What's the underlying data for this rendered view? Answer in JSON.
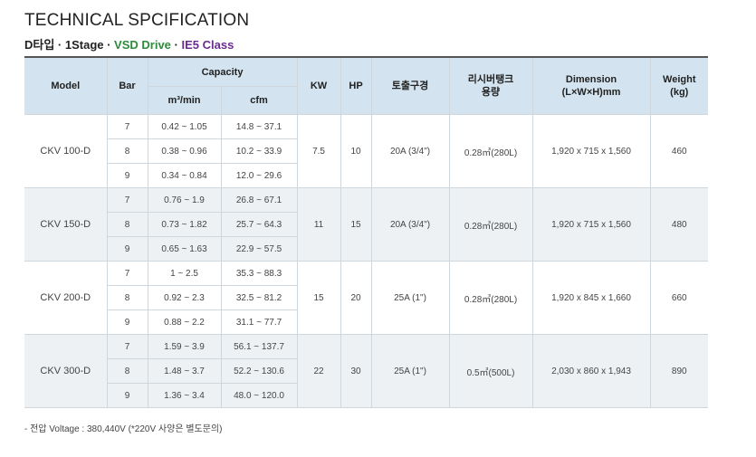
{
  "title": "TECHNICAL SPCIFICATION",
  "subtitle": {
    "part1": "D타입 · 1Stage · ",
    "part2": "VSD Drive",
    "sep": " · ",
    "part3": "IE5 Class"
  },
  "headers": {
    "model": "Model",
    "bar": "Bar",
    "capacity": "Capacity",
    "m3min": "m³/min",
    "cfm": "cfm",
    "kw": "KW",
    "hp": "HP",
    "outlet": "토출구경",
    "receiver_line1": "리시버탱크",
    "receiver_line2": "용량",
    "dimension_line1": "Dimension",
    "dimension_line2": "(L×W×H)mm",
    "weight_line1": "Weight",
    "weight_line2": "(kg)"
  },
  "rows": [
    {
      "model": "CKV 100-D",
      "kw": "7.5",
      "hp": "10",
      "outlet": "20A (3/4\")",
      "receiver": "0.28㎥(280L)",
      "dimension": "1,920 x 715 x 1,560",
      "weight": "460",
      "sub": [
        {
          "bar": "7",
          "m3": "0.42 ~ 1.05",
          "cfm": "14.8 ~ 37.1"
        },
        {
          "bar": "8",
          "m3": "0.38 ~ 0.96",
          "cfm": "10.2 ~ 33.9"
        },
        {
          "bar": "9",
          "m3": "0.34 ~ 0.84",
          "cfm": "12.0 ~ 29.6"
        }
      ]
    },
    {
      "model": "CKV 150-D",
      "kw": "11",
      "hp": "15",
      "outlet": "20A (3/4\")",
      "receiver": "0.28㎥(280L)",
      "dimension": "1,920 x 715 x 1,560",
      "weight": "480",
      "sub": [
        {
          "bar": "7",
          "m3": "0.76 ~ 1.9",
          "cfm": "26.8 ~ 67.1"
        },
        {
          "bar": "8",
          "m3": "0.73 ~ 1.82",
          "cfm": "25.7 ~ 64.3"
        },
        {
          "bar": "9",
          "m3": "0.65 ~ 1.63",
          "cfm": "22.9 ~ 57.5"
        }
      ]
    },
    {
      "model": "CKV 200-D",
      "kw": "15",
      "hp": "20",
      "outlet": "25A (1\")",
      "receiver": "0.28㎥(280L)",
      "dimension": "1,920 x 845 x 1,660",
      "weight": "660",
      "sub": [
        {
          "bar": "7",
          "m3": "1 ~ 2.5",
          "cfm": "35.3 ~ 88.3"
        },
        {
          "bar": "8",
          "m3": "0.92 ~ 2.3",
          "cfm": "32.5 ~ 81.2"
        },
        {
          "bar": "9",
          "m3": "0.88 ~ 2.2",
          "cfm": "31.1 ~ 77.7"
        }
      ]
    },
    {
      "model": "CKV 300-D",
      "kw": "22",
      "hp": "30",
      "outlet": "25A (1\")",
      "receiver": "0.5㎥(500L)",
      "dimension": "2,030 x 860 x 1,943",
      "weight": "890",
      "sub": [
        {
          "bar": "7",
          "m3": "1.59 ~ 3.9",
          "cfm": "56.1 ~ 137.7"
        },
        {
          "bar": "8",
          "m3": "1.48 ~ 3.7",
          "cfm": "52.2 ~ 130.6"
        },
        {
          "bar": "9",
          "m3": "1.36 ~ 3.4",
          "cfm": "48.0 ~ 120.0"
        }
      ]
    }
  ],
  "footnote": "- 전압 Voltage : 380,440V (*220V 사양은 별도문의)"
}
